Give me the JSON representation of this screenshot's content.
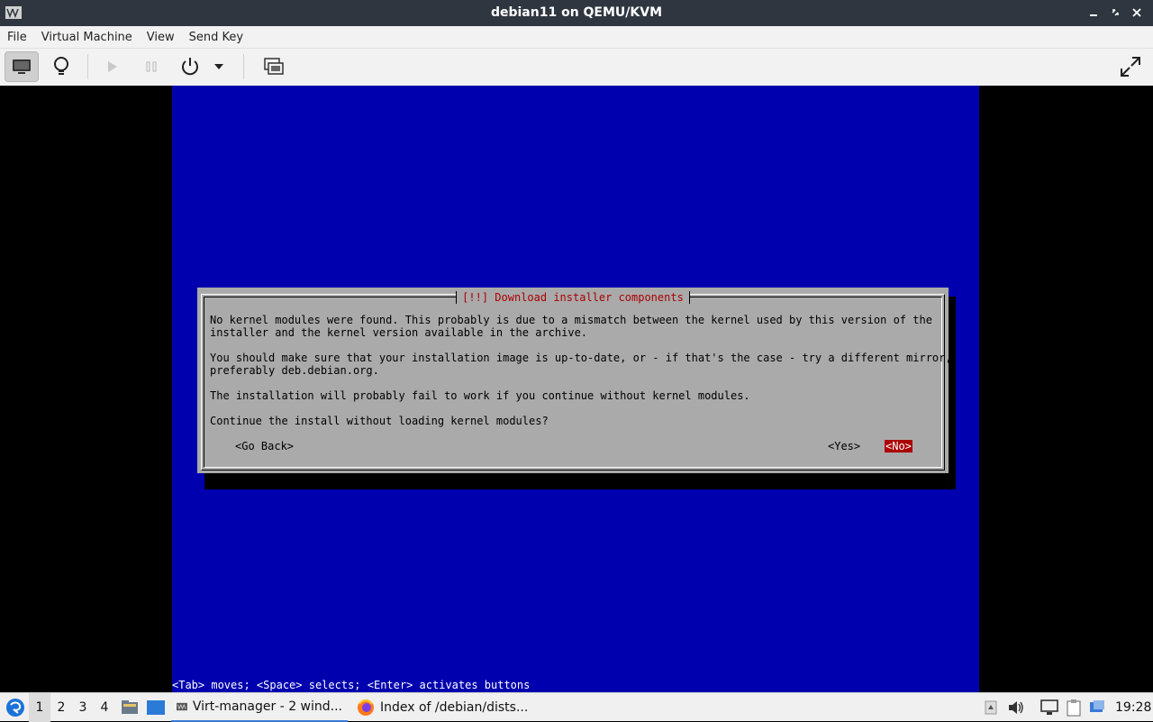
{
  "window": {
    "title": "debian11 on QEMU/KVM",
    "controls": [
      "minimize",
      "maximize",
      "close"
    ]
  },
  "menu": [
    "File",
    "Virtual Machine",
    "View",
    "Send Key"
  ],
  "toolbar": {
    "buttons": [
      "monitor-icon",
      "lightbulb-icon",
      "play-icon",
      "pause-icon",
      "power-icon",
      "dropdown-arrow-icon",
      "snapshots-icon",
      "fullscreen-icon"
    ]
  },
  "installer": {
    "dialog_title": "[!!] Download installer components",
    "para1": "No kernel modules were found. This probably is due to a mismatch between the kernel used by this version of the\ninstaller and the kernel version available in the archive.",
    "para2": "You should make sure that your installation image is up-to-date, or - if that's the case - try a different mirror,\npreferably deb.debian.org.",
    "para3": "The installation will probably fail to work if you continue without kernel modules.",
    "question": "Continue the install without loading kernel modules?",
    "go_back": "<Go Back>",
    "yes": "<Yes>",
    "no": "<No>",
    "hint": "<Tab> moves; <Space> selects; <Enter> activates buttons"
  },
  "taskbar": {
    "workspaces": [
      "1",
      "2",
      "3",
      "4"
    ],
    "active_workspace": "1",
    "tasks": [
      {
        "label": "Virt-manager - 2 wind...",
        "icon": "virt-manager-icon"
      },
      {
        "label": "Index of /debian/dists...",
        "icon": "firefox-icon"
      }
    ],
    "clock": "19:28"
  },
  "colors": {
    "installer_bg": "#0000ae",
    "dialog_bg": "#aaaaaa",
    "accent_red": "#aa0000",
    "titlebar": "#2f3640"
  }
}
